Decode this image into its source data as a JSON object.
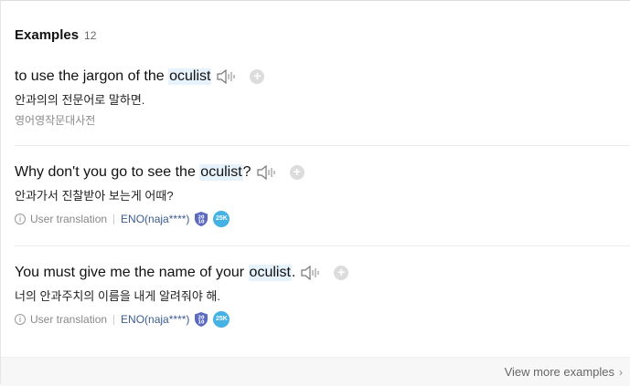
{
  "header": {
    "title": "Examples",
    "count": "12"
  },
  "examples": [
    {
      "before": "to use the jargon of the ",
      "highlight": "oculist",
      "after": "",
      "translation": "안과의의 전문어로 말하면.",
      "source": "영어영작문대사전"
    },
    {
      "before": "Why don't you go to see the ",
      "highlight": "oculist",
      "after": "?",
      "translation": "안과가서 진찰받아 보는게 어때?",
      "info_label": "User translation",
      "user": "ENO(naja****)",
      "badge1": "20\n10",
      "badge2": "25K"
    },
    {
      "before": "You must give me the name of your ",
      "highlight": "oculist",
      "after": ".",
      "translation": "너의 안과주치의 이름을 내게 알려줘야 해.",
      "info_label": "User translation",
      "user": "ENO(naja****)",
      "badge1": "20\n10",
      "badge2": "25K"
    }
  ],
  "icons": {
    "speaker": "speaker-icon",
    "add": "plus-icon",
    "info": "info-icon"
  },
  "colors": {
    "highlight": "#e6f2fc",
    "user_link": "#3b5b8f",
    "badge_circle": "#45b2e6",
    "badge_shield": "#5c6bc0"
  },
  "footer": {
    "more_label": "View more examples"
  }
}
